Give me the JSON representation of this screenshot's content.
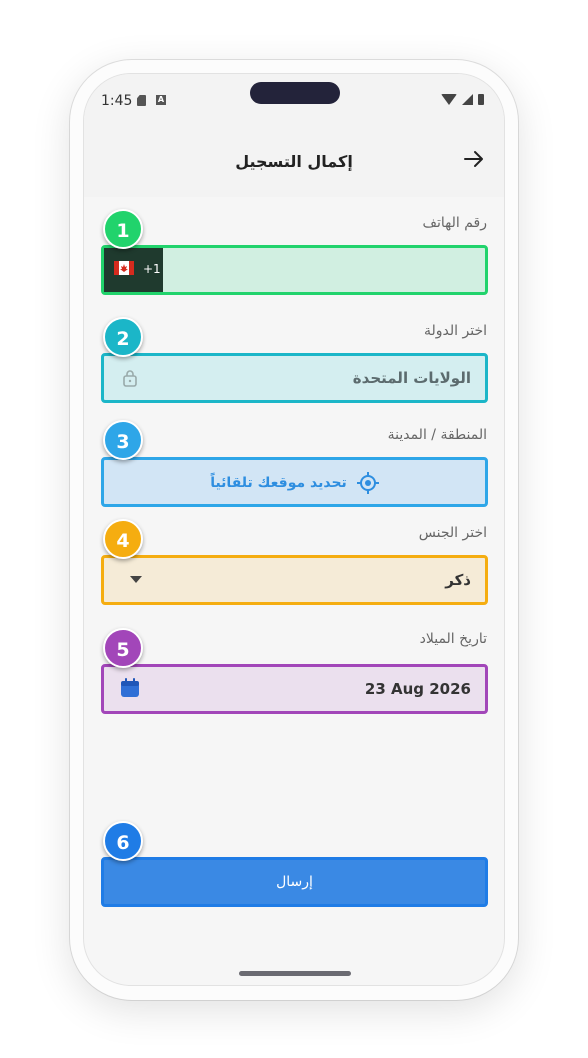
{
  "status_bar": {
    "time": "1:45"
  },
  "header": {
    "title": "إكمال التسجيل"
  },
  "colors": {
    "green": "#21d36c",
    "teal": "#1bb6c8",
    "blue": "#2ea6e8",
    "amber": "#f5ad10",
    "purple": "#a246b9",
    "submit": "#3a89e4"
  },
  "fields": {
    "phone": {
      "label": "رقم الهاتف",
      "code": "+1",
      "value": ""
    },
    "country": {
      "label": "اختر الدولة",
      "value": "الولايات المتحدة"
    },
    "region": {
      "label": "المنطقة / المدينة",
      "button_label": "تحديد موقعك تلقائياً"
    },
    "gender": {
      "label": "اختر الجنس",
      "value": "ذكر"
    },
    "birthdate": {
      "label": "تاريخ الميلاد",
      "value": "23 Aug 2026"
    }
  },
  "badges": [
    "1",
    "2",
    "3",
    "4",
    "5",
    "6"
  ],
  "submit": {
    "label": "إرسال"
  }
}
